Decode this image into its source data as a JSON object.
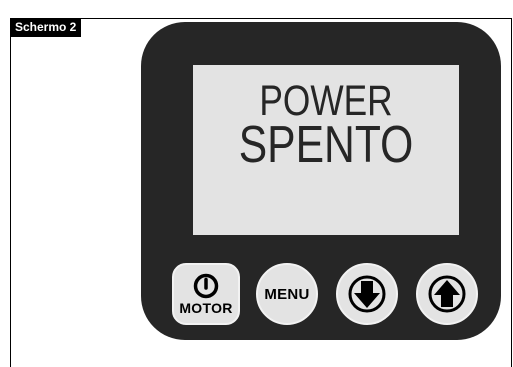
{
  "screen_label": "Schermo 2",
  "display": {
    "line1": "POWER",
    "line2": "SPENTO"
  },
  "buttons": {
    "motor_label": "MOTOR",
    "menu_label": "MENU"
  },
  "icons": {
    "motor": "power-icon",
    "down": "arrow-down-icon",
    "up": "arrow-up-icon"
  },
  "colors": {
    "device_body": "#262626",
    "screen_bg": "#e3e3e3",
    "button_bg": "#e3e3e3",
    "label_bg": "#000000",
    "label_text": "#ffffff"
  }
}
